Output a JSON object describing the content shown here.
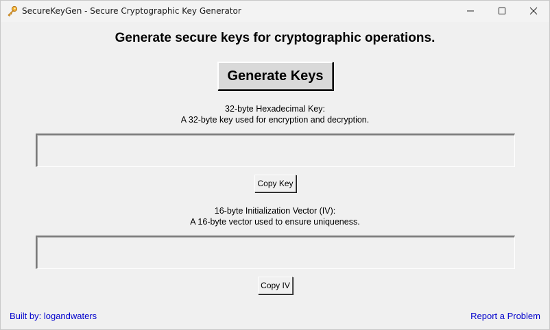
{
  "window": {
    "title": "SecureKeyGen - Secure Cryptographic Key Generator",
    "app_icon": "key-icon",
    "controls": [
      "minimize-icon",
      "maximize-icon",
      "close-icon"
    ]
  },
  "main": {
    "heading": "Generate secure keys for cryptographic operations.",
    "generate_button": "Generate Keys",
    "key_section": {
      "title": "32-byte Hexadecimal Key:",
      "description": "A 32-byte key used for encryption and decryption.",
      "value": "",
      "copy_button": "Copy Key"
    },
    "iv_section": {
      "title": "16-byte Initialization Vector (IV):",
      "description": "A 16-byte vector used to ensure uniqueness.",
      "value": "",
      "copy_button": "Copy IV"
    }
  },
  "footer": {
    "credit": "Built by: logandwaters",
    "report_link": "Report a Problem"
  },
  "colors": {
    "window_bg": "#f0f0f0",
    "link": "#0000cc",
    "button_face": "#d9d9d9"
  }
}
